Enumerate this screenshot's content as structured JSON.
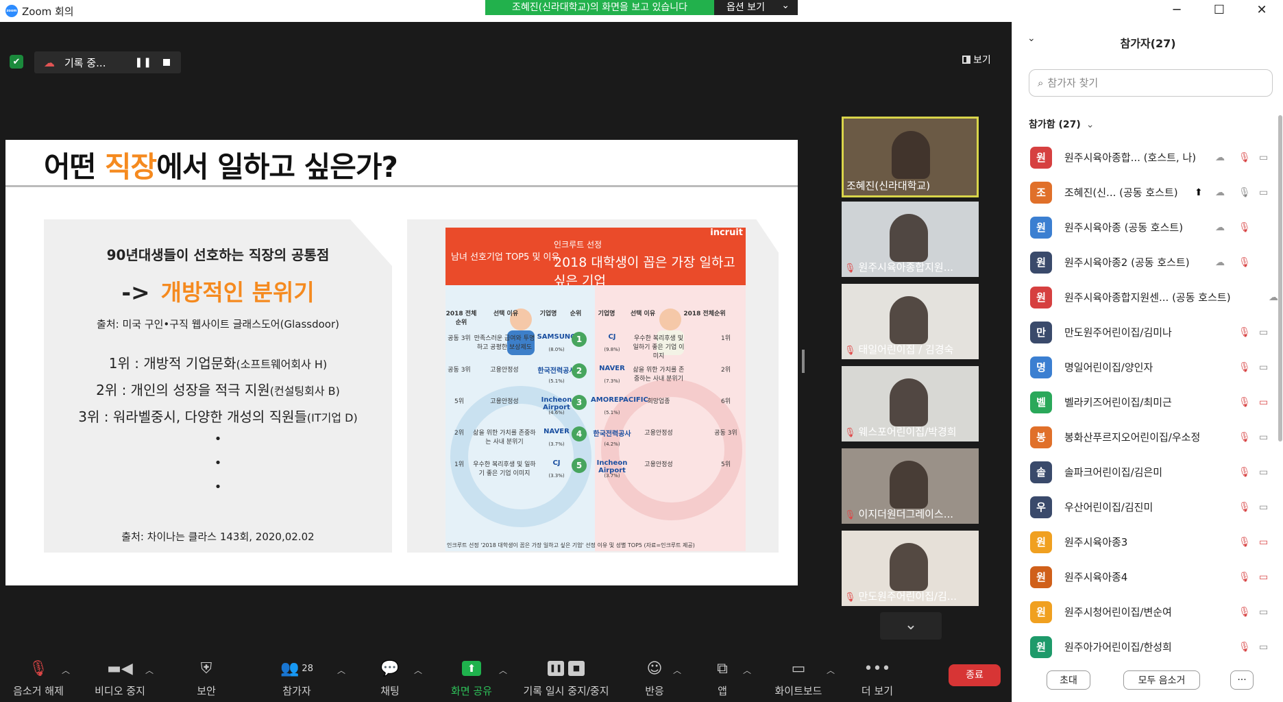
{
  "window": {
    "title": "Zoom 회의",
    "minimize": "─",
    "maximize": "☐",
    "close": "✕"
  },
  "share_banner": {
    "text": "조혜진(신라대학교)의 화면을 보고 있습니다",
    "options": "옵션 보기"
  },
  "recording": {
    "label": "기록 중...",
    "pause_icon": "❚❚",
    "stop_icon": "■"
  },
  "view_button": "보기",
  "slide": {
    "title_pre": "어떤 ",
    "title_highlight": "직장",
    "title_post": "에서 일하고 싶은가?",
    "left": {
      "heading": "90년대생들이 선호하는 직장의 공통점",
      "arrow": "->",
      "highlight": "개방적인 분위기",
      "source": "출처: 미국 구인•구직 웹사이트 글래스도어(Glassdoor)",
      "rank1": "1위 : 개방적 기업문화",
      "rank1_note": "(소프트웨어회사 H)",
      "rank2": "2위 : 개인의 성장을 적극 지원",
      "rank2_note": "(컨설팅회사 B)",
      "rank3": "3위 : 워라벨중시, 다양한 개성의 직원들",
      "rank3_note": "(IT기업 D)",
      "dots": [
        "•",
        "•",
        "•"
      ],
      "footer": "출처: 차이나는 클라스 143회, 2020,02.02"
    },
    "info": {
      "brand": "incruit",
      "tag_left": "남녀 선호기업 TOP5 및 이유",
      "tag_small": "인크루트 선정",
      "headline": "2018 대학생이 꼽은 가장 일하고 싶은 기업",
      "col_headers": [
        "2018 전체순위",
        "선택 이유",
        "기업명",
        "순위",
        "기업명",
        "선택 이유",
        "2018 전체순위"
      ],
      "ranks": [
        "1",
        "2",
        "3",
        "4",
        "5"
      ],
      "left_rows": [
        {
          "rank": "공동 3위",
          "reason": "만족스러운 급여와 투명하고 공평한 보상제도",
          "company": "SAMSUNG",
          "pct": "(8.0%)"
        },
        {
          "rank": "공동 3위",
          "reason": "고용안정성",
          "company": "한국전력공사",
          "pct": "(5.1%)"
        },
        {
          "rank": "5위",
          "reason": "고용안정성",
          "company": "Incheon Airport",
          "pct": "(4.6%)"
        },
        {
          "rank": "2위",
          "reason": "삶을 위한 가치를 존중하는 사내 분위기",
          "company": "NAVER",
          "pct": "(3.7%)"
        },
        {
          "rank": "1위",
          "reason": "우수한 복리후생 및 일하기 좋은 기업 이미지",
          "company": "CJ",
          "pct": "(3.3%)"
        }
      ],
      "right_rows": [
        {
          "company": "CJ",
          "pct": "(9.8%)",
          "reason": "우수한 복리후생 및 일하기 좋은 기업 이미지",
          "rank": "1위"
        },
        {
          "company": "NAVER",
          "pct": "(7.3%)",
          "reason": "삶을 위한 가치를 존중하는 사내 분위기",
          "rank": "2위"
        },
        {
          "company": "AMOREPACIFIC",
          "pct": "(5.1%)",
          "reason": "희망업종",
          "rank": "6위"
        },
        {
          "company": "한국전력공사",
          "pct": "(4.2%)",
          "reason": "고용안정성",
          "rank": "공동 3위"
        },
        {
          "company": "Incheon Airport",
          "pct": "(3.7%)",
          "reason": "고용안정성",
          "rank": "5위"
        }
      ],
      "caption": "인크루트 선정 '2018 대학생이 꼽은 가장 일하고 싶은 기업' 선정 이유 및 성별 TOP5 (자료=인크루트 제공)",
      "colors": {
        "header": "#ea4b2a",
        "male": "#e5f1f8",
        "female": "#fbe3e3",
        "rank": "#47a55e"
      }
    }
  },
  "thumbnails": [
    {
      "name": "조혜진(신라대학교)",
      "muted": false,
      "bg": "#6b5a45"
    },
    {
      "name": "원주시육아종합지원...",
      "muted": true,
      "bg": "#cfd3d6"
    },
    {
      "name": "태일어린이집 / 김경숙",
      "muted": true,
      "bg": "#e4e2dd"
    },
    {
      "name": "웨스포어린이집/박경희",
      "muted": true,
      "bg": "#d8d8d4"
    },
    {
      "name": "이지더원더그레이스...",
      "muted": true,
      "bg": "#9a9188"
    },
    {
      "name": "만도원주어린이집/김...",
      "muted": true,
      "bg": "#e6e0d8"
    }
  ],
  "toolbar": {
    "unmute": "음소거 해제",
    "video": "비디오 중지",
    "security": "보안",
    "participants": "참가자",
    "participants_count": "28",
    "chat": "채팅",
    "share": "화면 공유",
    "record": "기록 일시 중지/중지",
    "reactions": "반응",
    "apps": "앱",
    "whiteboard": "화이트보드",
    "more": "더 보기",
    "end": "종료"
  },
  "panel": {
    "title": "참가자(27)",
    "search_placeholder": "참가자 찾기",
    "group_label": "참가함 (27)",
    "group_chevron": "⌄",
    "participants": [
      {
        "avatar": "원",
        "color": "#d64040",
        "name": "원주시육아종합... (호스트, 나)",
        "rec": true,
        "mic": "off",
        "vid": "on"
      },
      {
        "avatar": "조",
        "color": "#e0702a",
        "name": "조혜진(신... (공동 호스트)",
        "share": true,
        "rec": true,
        "mic": "on",
        "vid": "on"
      },
      {
        "avatar": "원",
        "color": "#3b7fd1",
        "name": "원주시육아종 (공동 호스트)",
        "rec": true,
        "mic": "off",
        "vid": "none"
      },
      {
        "avatar": "원",
        "color": "#3a4a6b",
        "name": "원주시육아종2 (공동 호스트)",
        "rec": true,
        "mic": "off",
        "vid": "none"
      },
      {
        "avatar": "원",
        "color": "#d64040",
        "name": "원주시육아종합지원센... (공동 호스트)",
        "rec": true,
        "mic": "none",
        "vid": "none"
      },
      {
        "avatar": "만",
        "color": "#3a4a6b",
        "name": "만도원주어린이집/김미나",
        "mic": "off",
        "vid": "on"
      },
      {
        "avatar": "명",
        "color": "#3b7fd1",
        "name": "명일어린이집/양인자",
        "mic": "off",
        "vid": "on"
      },
      {
        "avatar": "벨",
        "color": "#2aa85a",
        "name": "벨라키즈어린이집/최미근",
        "mic": "off",
        "vid": "off"
      },
      {
        "avatar": "봉",
        "color": "#e0702a",
        "name": "봉화산푸르지오어린이집/우소정",
        "mic": "off",
        "vid": "on"
      },
      {
        "avatar": "솔",
        "color": "#3a4a6b",
        "name": "솔파크어린이집/김은미",
        "mic": "off",
        "vid": "on"
      },
      {
        "avatar": "우",
        "color": "#3a4a6b",
        "name": "우산어린이집/김진미",
        "mic": "off",
        "vid": "on"
      },
      {
        "avatar": "원",
        "color": "#f0a020",
        "name": "원주시육아종3",
        "mic": "off",
        "vid": "off"
      },
      {
        "avatar": "원",
        "color": "#d0601a",
        "name": "원주시육아종4",
        "mic": "off",
        "vid": "off"
      },
      {
        "avatar": "원",
        "color": "#f0a020",
        "name": "원주시청어린이집/변순여",
        "mic": "off",
        "vid": "on"
      },
      {
        "avatar": "원",
        "color": "#1e9a6a",
        "name": "원주아가어린이집/한성희",
        "mic": "off",
        "vid": "on"
      }
    ],
    "invite": "초대",
    "mute_all": "모두 음소거",
    "more": "···"
  }
}
